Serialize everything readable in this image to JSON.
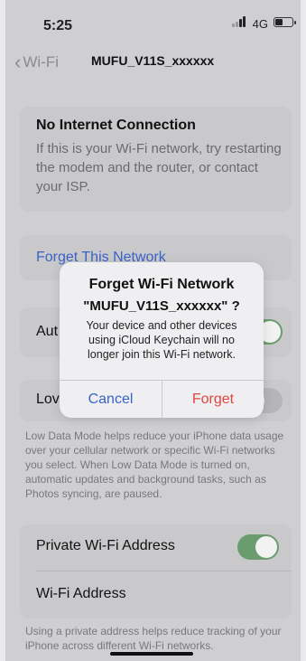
{
  "status": {
    "time": "5:25",
    "network": "4G",
    "battery_level": 0.45
  },
  "nav": {
    "back_label": "Wi-Fi",
    "title": "MUFU_V11S_xxxxxx"
  },
  "warning": {
    "title": "No Internet Connection",
    "body": "If this is your Wi-Fi network, try restarting the modem and the router, or contact your ISP."
  },
  "forget_link": "Forget This Network",
  "auto_join": {
    "label": "Aut",
    "on": true
  },
  "low_data": {
    "label": "Lov",
    "on": false,
    "footnote": "Low Data Mode helps reduce your iPhone data usage over your cellular network or specific Wi-Fi networks you select. When Low Data Mode is turned on, automatic updates and background tasks, such as Photos syncing, are paused."
  },
  "private": {
    "private_label": "Private Wi-Fi Address",
    "private_on": true,
    "address_label": "Wi-Fi Address",
    "footnote": "Using a private address helps reduce tracking of your iPhone across different Wi-Fi networks."
  },
  "dialog": {
    "title": "Forget Wi-Fi Network",
    "network_name": "\"MUFU_V11S_xxxxxx\"  ?",
    "message": "Your device and other devices using iCloud Keychain will no longer join this Wi-Fi network.",
    "cancel_label": "Cancel",
    "forget_label": "Forget"
  },
  "colors": {
    "accent": "#3a63c8",
    "destructive": "#e0463f",
    "toggle_on": "#6a9c6d"
  },
  "icons": [
    "signal-icon",
    "battery-icon",
    "chevron-left-icon"
  ]
}
